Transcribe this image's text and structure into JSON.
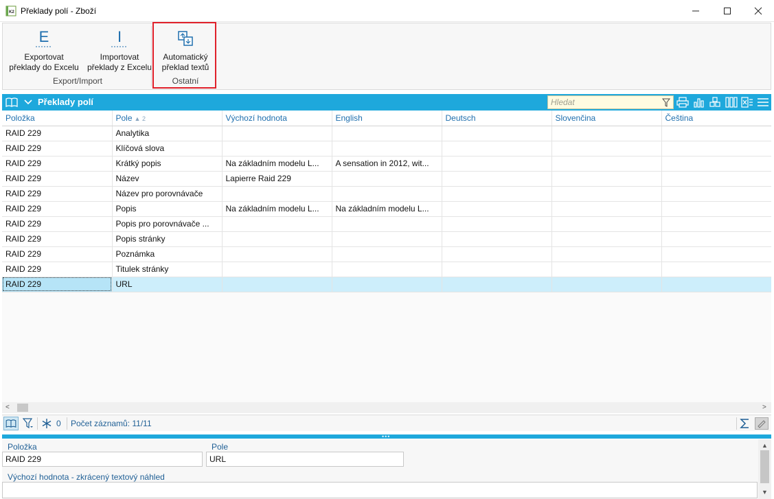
{
  "window": {
    "title": "Překlady polí - Zboží"
  },
  "ribbon": {
    "groups": [
      {
        "label": "Export/Import",
        "buttons": [
          {
            "label_line1": "Exportovat",
            "label_line2": "překlady do Excelu",
            "icon": "export-excel-icon",
            "glyph": "E"
          },
          {
            "label_line1": "Importovat",
            "label_line2": "překlady z Excelu",
            "icon": "import-excel-icon",
            "glyph": "I"
          }
        ]
      },
      {
        "label": "Ostatní",
        "buttons": [
          {
            "label_line1": "Automatický",
            "label_line2": "překlad textů",
            "icon": "auto-translate-icon"
          }
        ]
      }
    ]
  },
  "grid": {
    "title": "Překlady polí",
    "search_placeholder": "Hledat",
    "columns": [
      "Položka",
      "Pole",
      "Výchozí hodnota",
      "English",
      "Deutsch",
      "Slovenčina",
      "Čeština"
    ],
    "sort_indicator": "▲ 2",
    "rows": [
      [
        "RAID 229",
        "Analytika",
        "",
        "",
        "",
        "",
        ""
      ],
      [
        "RAID 229",
        "Klíčová slova",
        "",
        "",
        "",
        "",
        ""
      ],
      [
        "RAID 229",
        "Krátký popis",
        "Na základním modelu L...",
        "A sensation in 2012, wit...",
        "",
        "",
        ""
      ],
      [
        "RAID 229",
        "Název",
        "Lapierre Raid 229",
        "",
        "",
        "",
        ""
      ],
      [
        "RAID 229",
        "Název pro porovnávače",
        "",
        "",
        "",
        "",
        ""
      ],
      [
        "RAID 229",
        "Popis",
        "Na základním modelu L...",
        "Na základním modelu L...",
        "",
        "",
        ""
      ],
      [
        "RAID 229",
        "Popis pro porovnávače ...",
        "",
        "",
        "",
        "",
        ""
      ],
      [
        "RAID 229",
        "Popis stránky",
        "",
        "",
        "",
        "",
        ""
      ],
      [
        "RAID 229",
        "Poznámka",
        "",
        "",
        "",
        "",
        ""
      ],
      [
        "RAID 229",
        "Titulek stránky",
        "",
        "",
        "",
        "",
        ""
      ],
      [
        "RAID 229",
        "URL",
        "",
        "",
        "",
        "",
        ""
      ]
    ],
    "selected_row": 10
  },
  "status": {
    "filter_count": "0",
    "record_count": "Počet záznamů: 11/11"
  },
  "detail": {
    "polozka_label": "Položka",
    "polozka_value": "RAID 229",
    "pole_label": "Pole",
    "pole_value": "URL",
    "preview_label": "Výchozí hodnota - zkrácený textový náhled"
  },
  "colors": {
    "accent": "#1ea8dc",
    "highlight_border": "#e0202a",
    "selected_row": "#cdeefb",
    "header_text": "#1f6fae"
  }
}
